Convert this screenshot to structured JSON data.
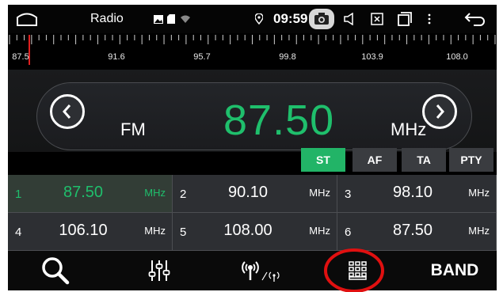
{
  "status": {
    "app_title": "Radio",
    "time": "09:59",
    "icons": [
      "home-icon",
      "image-icon",
      "sd-card-icon",
      "wifi-icon",
      "location-icon",
      "camera-icon",
      "volume-icon",
      "close-box-icon",
      "window-icon",
      "more-icon",
      "back-icon"
    ]
  },
  "ruler": {
    "labels": [
      "87.5",
      "91.6",
      "95.7",
      "99.8",
      "103.9",
      "108.0"
    ],
    "marker_color": "#e02020"
  },
  "main": {
    "band": "FM",
    "frequency": "87.50",
    "unit": "MHz",
    "accent": "#1fbf6c"
  },
  "options": [
    {
      "label": "ST",
      "active": true
    },
    {
      "label": "AF",
      "active": false
    },
    {
      "label": "TA",
      "active": false
    },
    {
      "label": "PTY",
      "active": false
    }
  ],
  "presets": [
    {
      "num": "1",
      "freq": "87.50",
      "unit": "MHz",
      "selected": true
    },
    {
      "num": "2",
      "freq": "90.10",
      "unit": "MHz",
      "selected": false
    },
    {
      "num": "3",
      "freq": "98.10",
      "unit": "MHz",
      "selected": false
    },
    {
      "num": "4",
      "freq": "106.10",
      "unit": "MHz",
      "selected": false
    },
    {
      "num": "5",
      "freq": "108.00",
      "unit": "MHz",
      "selected": false
    },
    {
      "num": "6",
      "freq": "87.50",
      "unit": "MHz",
      "selected": false
    }
  ],
  "toolbar": {
    "icons": [
      "search-icon",
      "equalizer-icon",
      "antenna-icon",
      "grid-icon"
    ],
    "band_label": "BAND",
    "highlight_color": "#e01010"
  }
}
